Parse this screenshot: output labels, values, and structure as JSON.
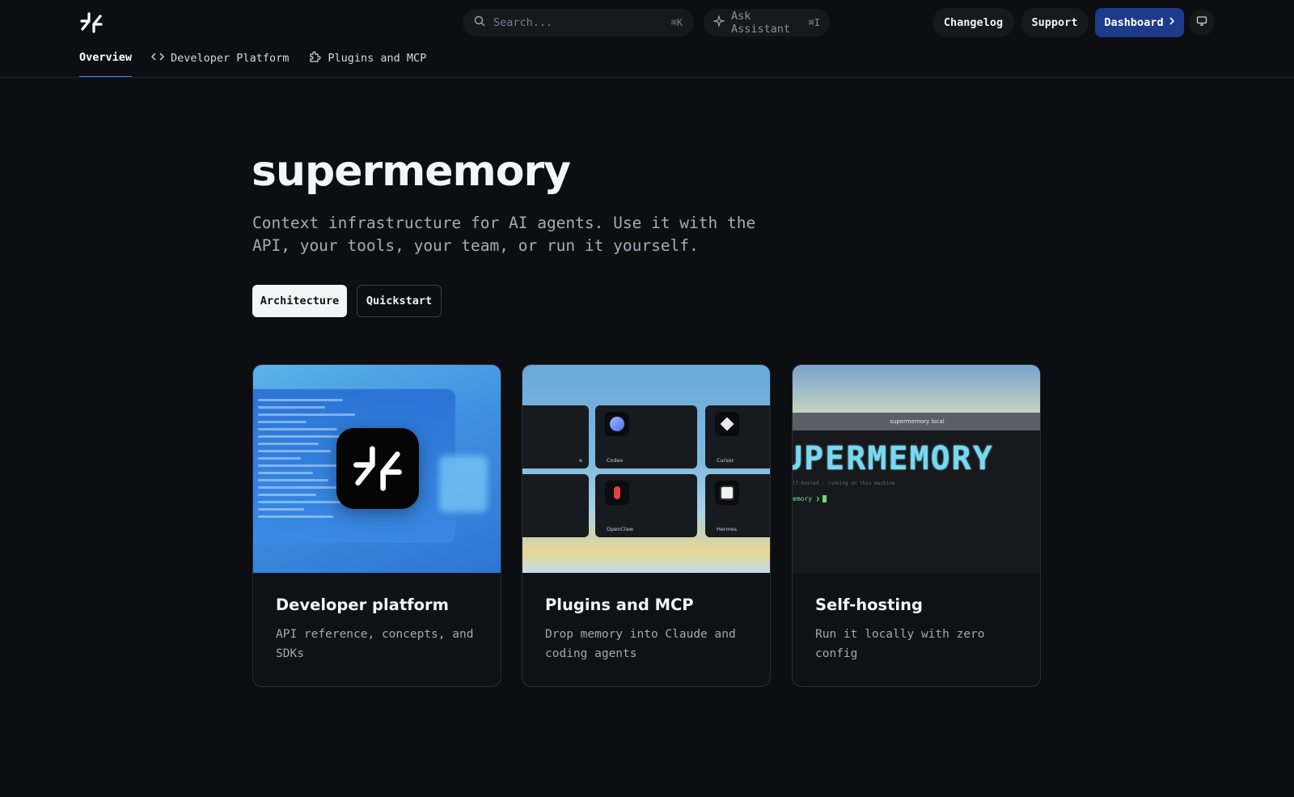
{
  "header": {
    "search_placeholder": "Search...",
    "search_shortcut": "⌘K",
    "assistant_label": "Ask Assistant",
    "assistant_shortcut": "⌘I",
    "changelog_label": "Changelog",
    "support_label": "Support",
    "dashboard_label": "Dashboard"
  },
  "tabs": [
    {
      "label": "Overview",
      "active": true
    },
    {
      "label": "Developer Platform",
      "active": false
    },
    {
      "label": "Plugins and MCP",
      "active": false
    }
  ],
  "hero": {
    "title": "supermemory",
    "subtitle": "Context infrastructure for AI agents. Use it with the API, your tools, your team, or run it yourself.",
    "buttons": [
      "Architecture",
      "Quickstart"
    ]
  },
  "cards": [
    {
      "title": "Developer platform",
      "description": "API reference, concepts, and SDKs"
    },
    {
      "title": "Plugins and MCP",
      "description": "Drop memory into Claude and coding agents",
      "tiles": [
        "e",
        "Codex",
        "Cursor",
        "",
        "OpenClaw",
        "Hermes"
      ]
    },
    {
      "title": "Self-hosting",
      "description": "Run it locally with zero config",
      "terminal": {
        "window_title": "supermemory local",
        "banner": "UPERMEMORY",
        "status_line": "lf-hosted · running on this machine",
        "prompt": "emory ❯"
      }
    }
  ],
  "colors": {
    "accent": "#3b82f6",
    "dashboard_bg": "#1e3a8a",
    "page_bg": "#0c0e12"
  }
}
